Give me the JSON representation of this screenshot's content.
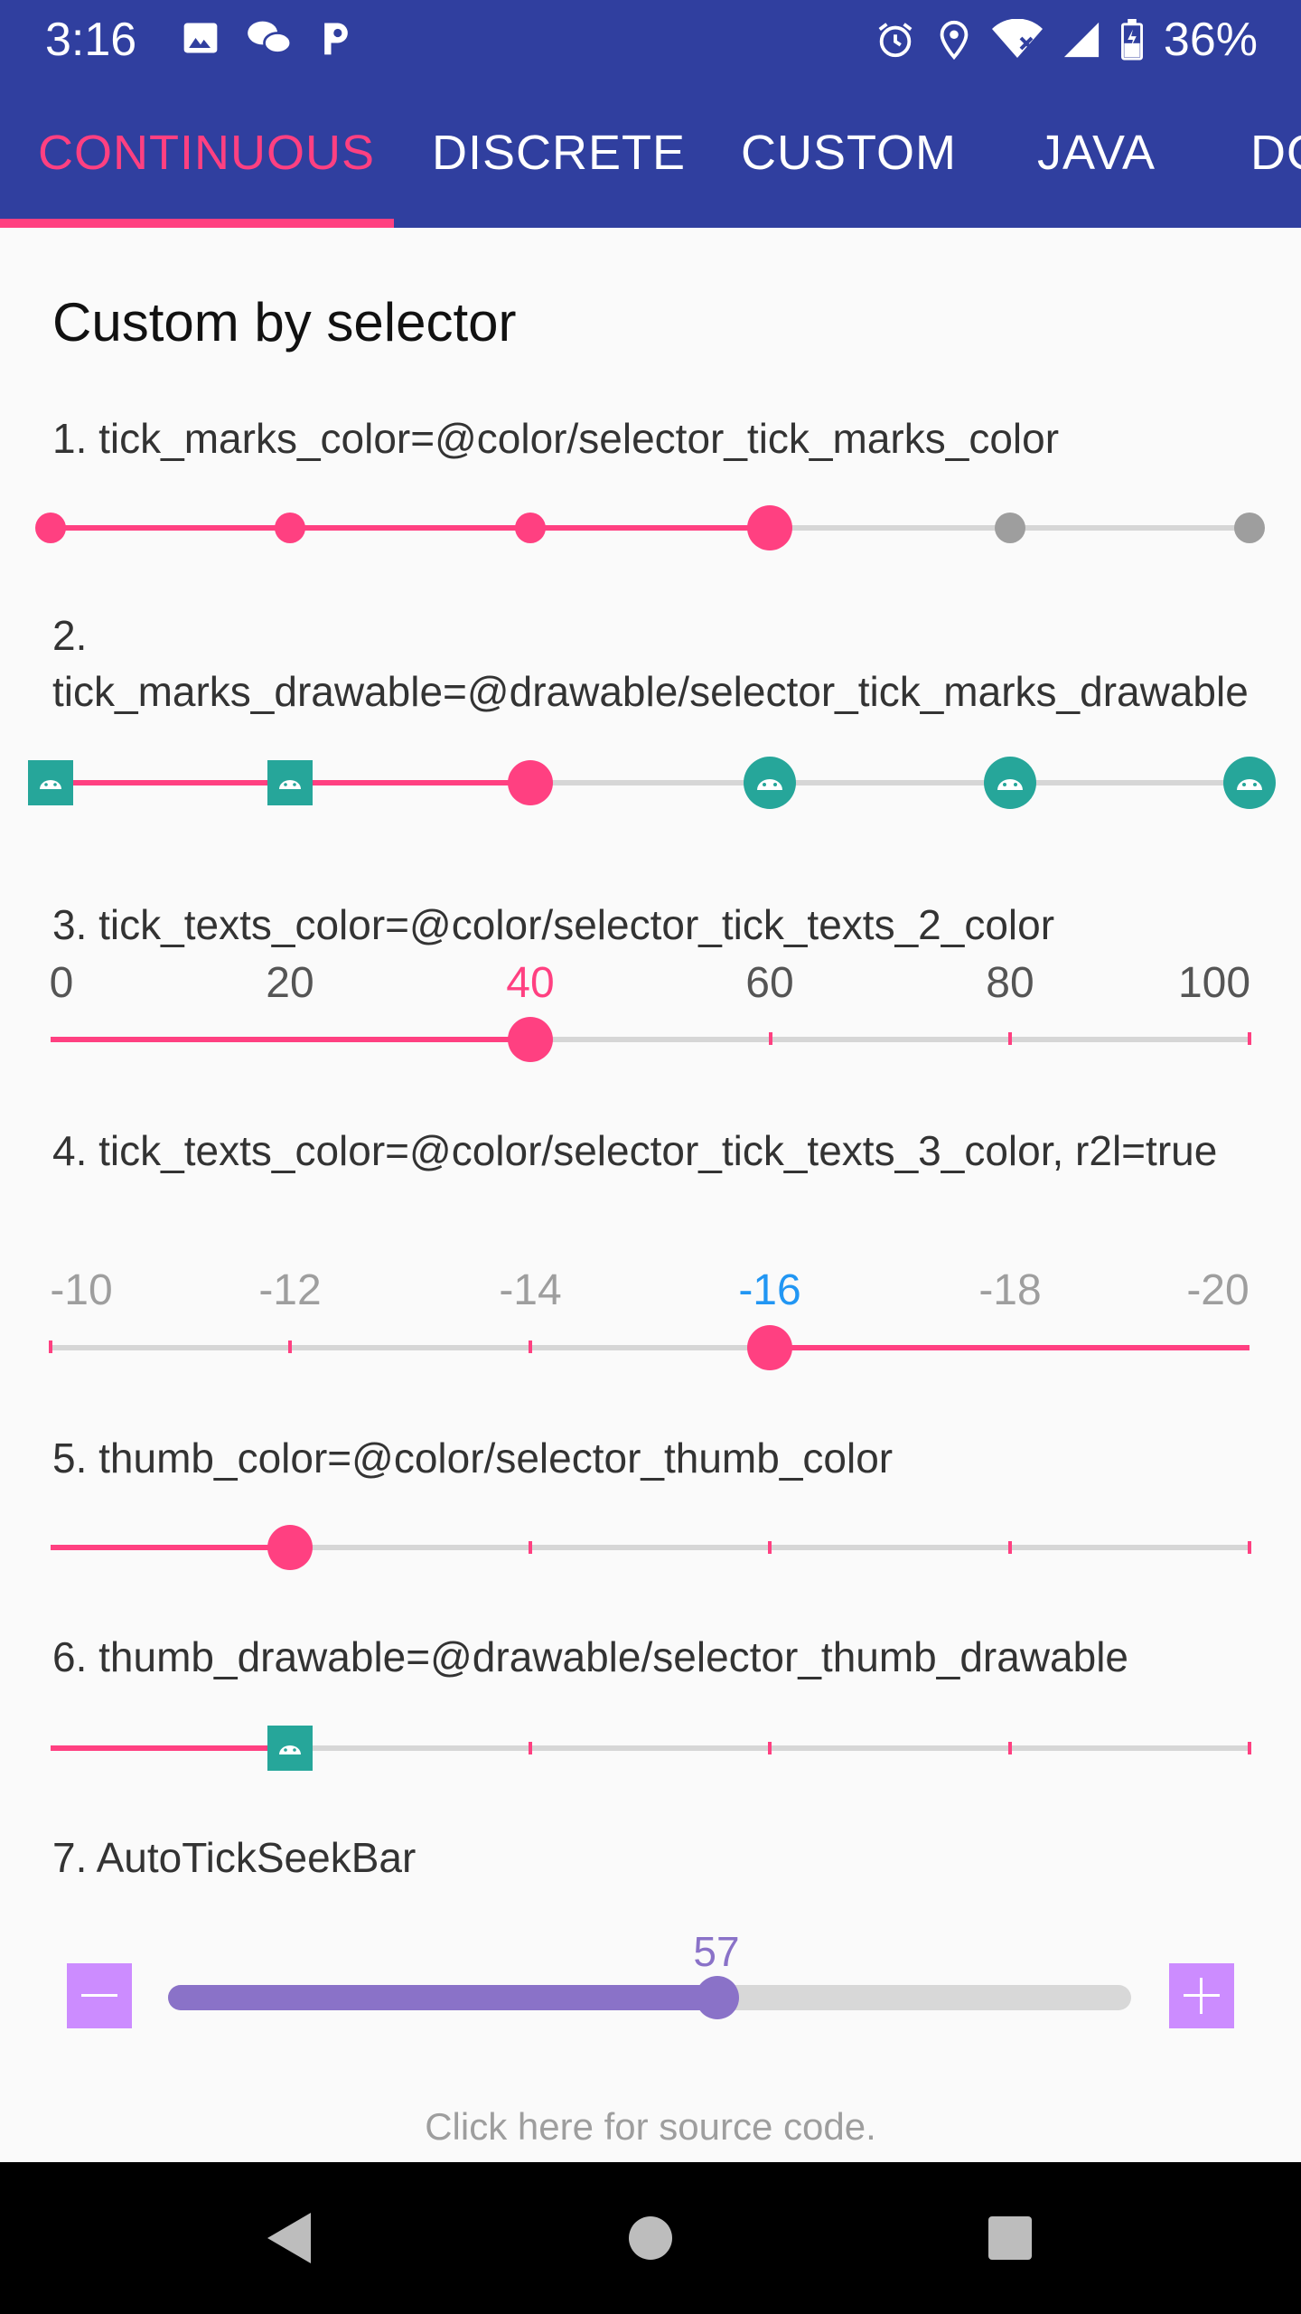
{
  "status_bar": {
    "time": "3:16",
    "battery_pct": "36%",
    "icons_left": [
      "image-icon",
      "wechat-icon",
      "p-icon"
    ],
    "icons_right": [
      "alarm-icon",
      "location-icon",
      "wifi-icon",
      "signal-icon",
      "battery-icon"
    ]
  },
  "tabs": [
    {
      "label": "CONTINUOUS",
      "active": true
    },
    {
      "label": "DISCRETE",
      "active": false
    },
    {
      "label": "CUSTOM",
      "active": false
    },
    {
      "label": "JAVA",
      "active": false
    },
    {
      "label": "DO",
      "active": false
    }
  ],
  "colors": {
    "primary": "#303f9f",
    "accent": "#ff4081",
    "teal": "#26a69a",
    "purple": "#8a72c8",
    "plus_minus": "#cc8cff",
    "blue_text": "#2196f3"
  },
  "page": {
    "title": "Custom by selector",
    "items": [
      {
        "label": "1. tick_marks_color=@color/selector_tick_marks_color",
        "progress": 0.6
      },
      {
        "label": "2. tick_marks_drawable=@drawable/selector_tick_marks_drawable",
        "progress": 0.4
      },
      {
        "label": "3. tick_texts_color=@color/selector_tick_texts_2_color",
        "tick_texts": [
          "0",
          "20",
          "40",
          "60",
          "80",
          "100"
        ],
        "value": 40
      },
      {
        "label": "4. tick_texts_color=@color/selector_tick_texts_3_color, r2l=true",
        "tick_texts": [
          "-10",
          "-12",
          "-14",
          "-16",
          "-18",
          "-20"
        ],
        "value": -16
      },
      {
        "label": "5. thumb_color=@color/selector_thumb_color",
        "progress": 0.2
      },
      {
        "label": "6. thumb_drawable=@drawable/selector_thumb_drawable",
        "progress": 0.2
      },
      {
        "label": "7. AutoTickSeekBar",
        "value": "57",
        "progress": 0.57
      }
    ],
    "source_link": "Click here for source code."
  },
  "navbar": {
    "buttons": [
      "back-icon",
      "home-icon",
      "recents-icon"
    ]
  }
}
